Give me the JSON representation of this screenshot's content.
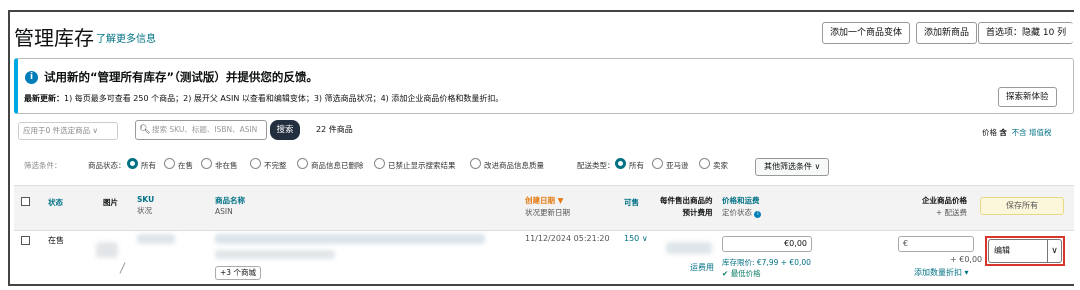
{
  "header": {
    "title": "管理库存",
    "learn_more": "了解更多信息",
    "btn_add_variant": "添加一个商品变体",
    "btn_add_product": "添加新商品",
    "btn_preferences": "首选项：隐藏 10 列"
  },
  "banner": {
    "icon": "info-icon",
    "headline": "试用新的“管理所有库存”（测试版）并提供您的反馈。",
    "update_label": "最新更新：",
    "update_text": "1) 每页最多可查看 250 个商品；2) 展开父 ASIN 以查看和编辑变体；3) 筛选商品状况；4) 添加企业商品价格和数量折扣。",
    "try_button": "探索新体验"
  },
  "toolbar": {
    "bulk_select": "应用于0 件选定商品",
    "search_placeholder": "搜索 SKU、标题、ISBN、ASIN",
    "search_button": "搜索",
    "count": "22 件商品",
    "tax_label": "价格",
    "tax_incl": "含",
    "tax_excl": "不含 增值税"
  },
  "filters": {
    "label": "筛选条件：",
    "status_label": "商品状态：",
    "status_options": [
      "所有",
      "在售",
      "非在售",
      "不完整",
      "商品信息已删除",
      "已禁止显示搜索结果",
      "改进商品信息质量"
    ],
    "fulfill_label": "配送类型：",
    "fulfill_options": [
      "所有",
      "亚马逊",
      "卖家"
    ],
    "more_button": "其他筛选条件 ∨"
  },
  "table": {
    "headers": {
      "status": "状态",
      "image": "图片",
      "sku": "SKU",
      "sku_sub": "状况",
      "name": "商品名称",
      "name_sub": "ASIN",
      "created": "创建日期 ▼",
      "created_sub": "状况更新日期",
      "available": "可售",
      "fee_a": "每件售出商品的",
      "fee_b": "预计费用",
      "price": "价格和运费",
      "price_sub": "定价状态",
      "business": "企业商品价格",
      "business_sub": "+ 配送费",
      "save_all": "保存所有"
    },
    "row": {
      "status": "在售",
      "created": "11/12/2024 05:21:20",
      "available": "150",
      "fee_tag": "运费用",
      "price_value": "€0,00",
      "price_note": "库存限价: €7,99 + €0,00",
      "lowest": "最低价格",
      "biz_prefix": "€",
      "biz_ship": "+ €0,00",
      "add_discount": "添加数量折扣 ▾",
      "more_variants": "+3 个商城",
      "action": "编辑"
    }
  },
  "colors": {
    "accent": "#007185",
    "banner_border": "#00a8e1",
    "highlight": "#d9362b"
  }
}
